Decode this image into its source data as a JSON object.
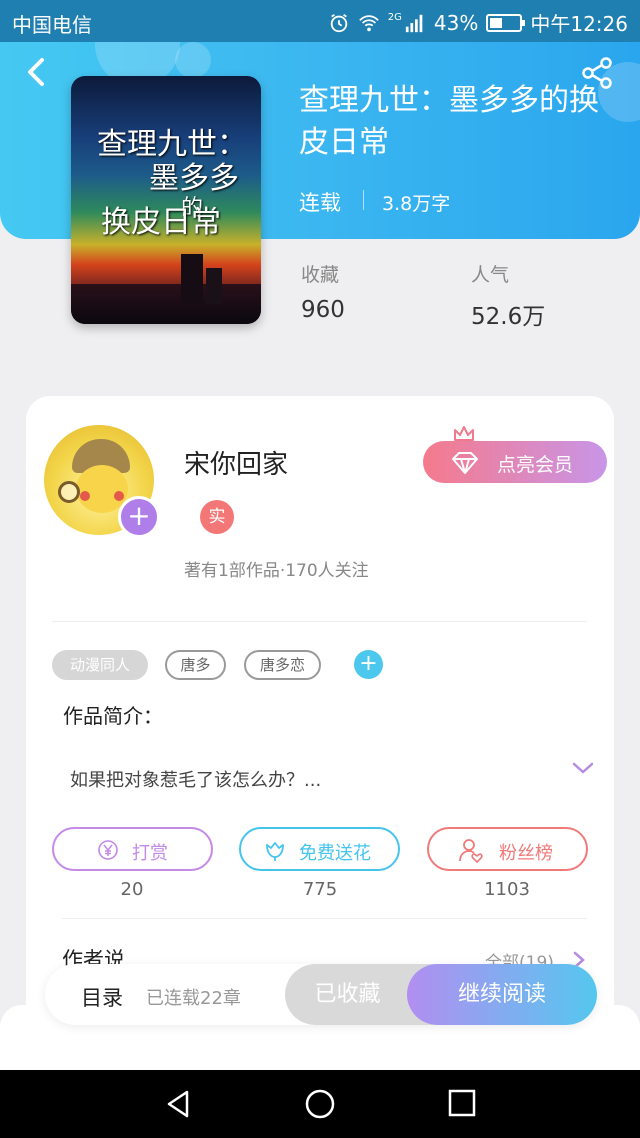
{
  "status_bar": {
    "carrier": "中国电信",
    "battery": "43%",
    "battery_level": 0.43,
    "time": "中午12:26",
    "network": "2G",
    "icons": [
      "alarm-icon",
      "wifi-icon",
      "signal-icon",
      "battery-icon"
    ]
  },
  "header": {
    "back_icon": "back-icon",
    "share_icon": "share-icon",
    "gradient": [
      "#45c9f2",
      "#2aa6ee"
    ]
  },
  "book": {
    "cover_text": [
      "查理九世：",
      "墨多多",
      "的",
      "换皮日常"
    ],
    "title": "查理九世：墨多多的换皮日常",
    "status": "连载",
    "word_count": "3.8万字",
    "collect_label": "收藏",
    "collect_value": "960",
    "popularity_label": "人气",
    "popularity_value": "52.6万"
  },
  "author": {
    "name": "宋你回家",
    "badge": "实",
    "meta": "著有1部作品·170人关注",
    "plus": "+"
  },
  "vip": {
    "label": "点亮会员",
    "icons": [
      "crown-icon",
      "diamond-icon"
    ]
  },
  "tags": [
    "动漫同人",
    "唐多",
    "唐多恋"
  ],
  "tag_add": "+",
  "intro": {
    "title": "作品简介：",
    "text": "如果把对象惹毛了该怎么办？..."
  },
  "actions": [
    {
      "label": "打赏",
      "count": "20",
      "icon": "yen-coin-icon",
      "color": "#c38ae8"
    },
    {
      "label": "免费送花",
      "count": "775",
      "icon": "flower-icon",
      "color": "#45c4ee"
    },
    {
      "label": "粉丝榜",
      "count": "1103",
      "icon": "fan-heart-icon",
      "color": "#f07a7a"
    }
  ],
  "author_says": {
    "title": "作者说",
    "see_all": "全部(19)"
  },
  "bottom_bar": {
    "toc": "目录",
    "chapters": "已连载22章",
    "collected": "已收藏",
    "read": "继续阅读"
  },
  "nav": {
    "icons": [
      "back-triangle-icon",
      "home-circle-icon",
      "recents-square-icon"
    ]
  }
}
